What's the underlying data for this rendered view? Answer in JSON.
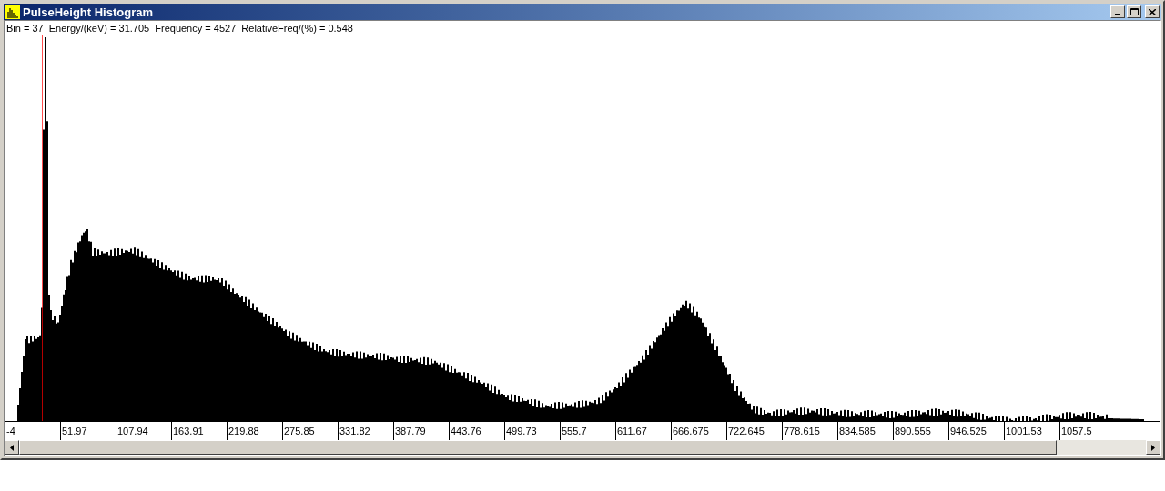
{
  "window": {
    "title": "PulseHeight Histogram"
  },
  "status_line": "Bin = 37  Energy/(keV) = 31.705  Frequency = 4527  RelativeFreq/(%) = 0.548",
  "x_axis_labels": [
    "-4",
    "51.97",
    "107.94",
    "163.91",
    "219.88",
    "275.85",
    "331.82",
    "387.79",
    "443.76",
    "499.73",
    "555.7",
    "611.67",
    "666.675",
    "722.645",
    "778.615",
    "834.585",
    "890.555",
    "946.525",
    "1001.53",
    "1057.5"
  ]
}
